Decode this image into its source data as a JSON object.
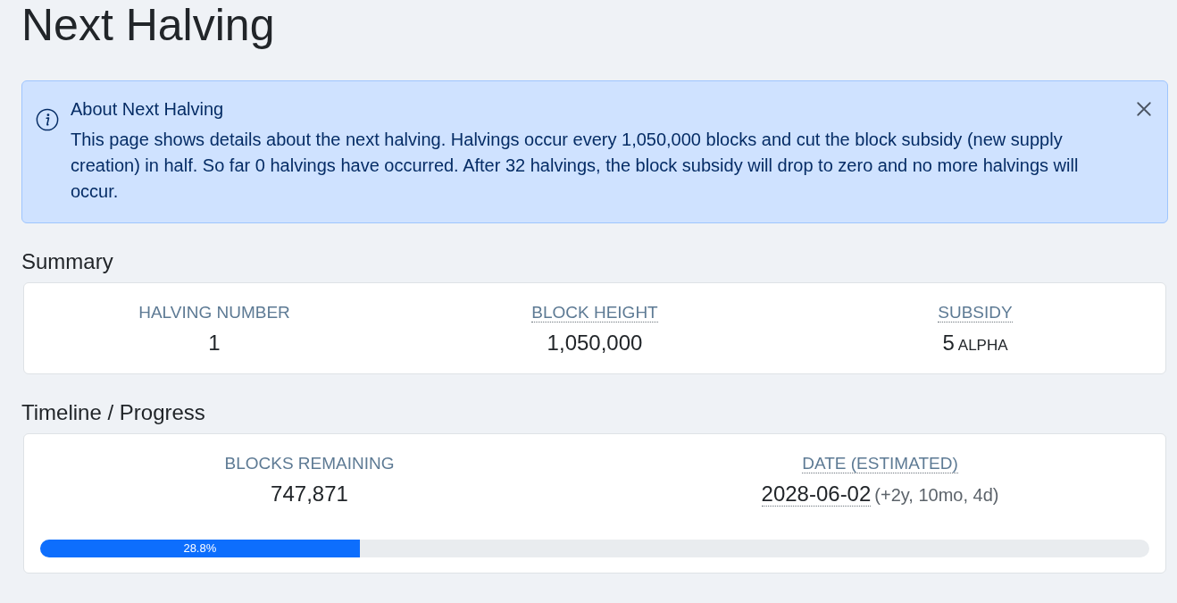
{
  "page": {
    "title": "Next Halving"
  },
  "alert": {
    "title": "About Next Halving",
    "text": "This page shows details about the next halving. Halvings occur every 1,050,000 blocks and cut the block subsidy (new supply creation) in half. So far 0 halvings have occurred. After 32 halvings, the block subsidy will drop to zero and no more halvings will occur."
  },
  "sections": [
    {
      "heading": "Summary",
      "stats": [
        {
          "label": "HALVING NUMBER",
          "label_tooltip": false,
          "value": "1",
          "value_tooltip": false
        },
        {
          "label": "BLOCK HEIGHT",
          "label_tooltip": true,
          "value": "1,050,000",
          "value_tooltip": false
        },
        {
          "label": "SUBSIDY",
          "label_tooltip": true,
          "value": "5",
          "value_tooltip": false,
          "unit": "ALPHA"
        }
      ]
    },
    {
      "heading": "Timeline / Progress",
      "stats": [
        {
          "label": "BLOCKS REMAINING",
          "label_tooltip": false,
          "value": "747,871",
          "value_tooltip": false
        },
        {
          "label": "DATE (ESTIMATED)",
          "label_tooltip": true,
          "value": "2028-06-02",
          "value_tooltip": true,
          "note": "(+2y, 10mo, 4d)"
        }
      ],
      "progress": {
        "level": 0.288,
        "label": "28.8%"
      }
    }
  ]
}
